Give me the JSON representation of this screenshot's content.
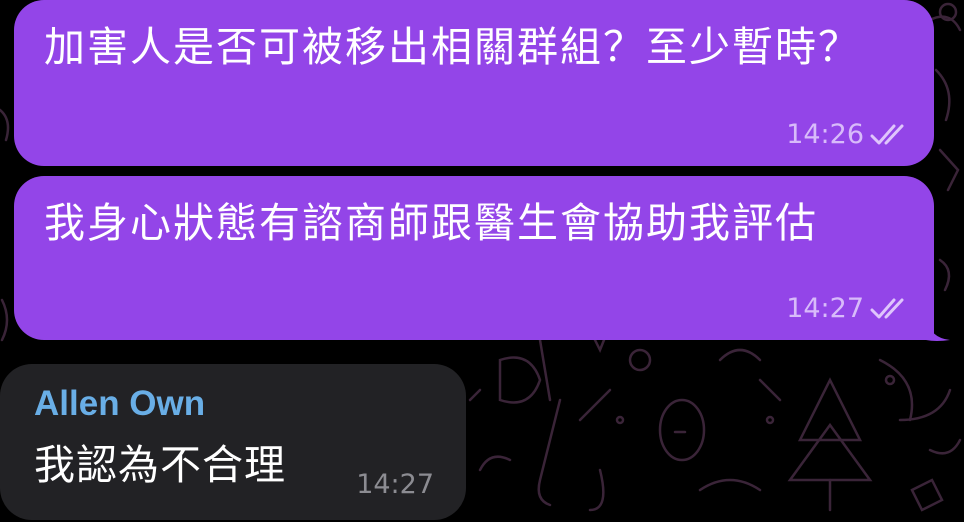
{
  "messages": [
    {
      "direction": "outgoing",
      "text": "加害人是否可被移出相關群組？至少暫時？",
      "time": "14:26",
      "status_icon": "double-check-icon"
    },
    {
      "direction": "outgoing",
      "text": "我身心狀態有諮商師跟醫生會協助我評估",
      "time": "14:27",
      "status_icon": "double-check-icon"
    },
    {
      "direction": "incoming",
      "sender": "Allen Own",
      "text": "我認為不合理",
      "time": "14:27"
    }
  ],
  "colors": {
    "background": "#000000",
    "outgoing_bubble": "#9345e8",
    "incoming_bubble": "#222225",
    "sender_name": "#69aee6",
    "doodle_lines": "#3a2438"
  }
}
